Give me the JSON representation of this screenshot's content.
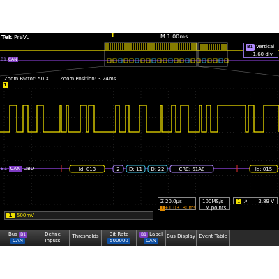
{
  "header": {
    "logo": "Tek",
    "mode": "PreVu",
    "timebase": "M 1.00ms"
  },
  "vertical": {
    "label": "Vertical",
    "value": "-1.60 div",
    "channel": "B1"
  },
  "zoom_info": {
    "factor": "Zoom Factor: 50 X",
    "position": "Zoom Position: 3.24ms"
  },
  "bus": {
    "tag": "B1",
    "name": "CAN",
    "overview_tag": "B1",
    "overview_name": "CAN",
    "zoom_prefix": "DBD",
    "frames": [
      {
        "text": "Id: 013",
        "color": "#f1e000"
      },
      {
        "text": "2",
        "color": "#b18bff"
      },
      {
        "text": "D: 11",
        "color": "#43c6e8"
      },
      {
        "text": "D: 22",
        "color": "#43c6e8"
      },
      {
        "text": "CRC: 61A8",
        "color": "#b18bff"
      },
      {
        "text": "Id: 015",
        "color": "#f1e000"
      }
    ]
  },
  "ch1": {
    "number": "1",
    "scale": "500mV"
  },
  "time_meas": {
    "line1": "20.0µs",
    "line2": "+1.03180ms",
    "icon": "T"
  },
  "sample_meas": {
    "line1": "100MS/s",
    "line2": "1M points"
  },
  "trigger_meas": {
    "ch": "1",
    "slope": "↗",
    "level": "2.89 V"
  },
  "markers": {
    "trigger": "T",
    "zoom_ch": "1",
    "wave_ch": "1"
  },
  "softkeys": [
    {
      "label": "Bus",
      "tag": "B1",
      "value": "CAN"
    },
    {
      "label": "Define Inputs",
      "tag": "",
      "value": ""
    },
    {
      "label": "Thresholds",
      "tag": "",
      "value": ""
    },
    {
      "label": "Bit Rate",
      "tag": "",
      "value": "500000"
    },
    {
      "label": "Label",
      "tag": "B1",
      "value": "CAN"
    },
    {
      "label": "Bus Display",
      "tag": "",
      "value": ""
    },
    {
      "label": "Event Table",
      "tag": "",
      "value": ""
    }
  ],
  "colors": {
    "ch1": "#f1e000",
    "bus": "#7d3ac1",
    "data": "#43c6e8",
    "grid": "#3a3a3a"
  }
}
